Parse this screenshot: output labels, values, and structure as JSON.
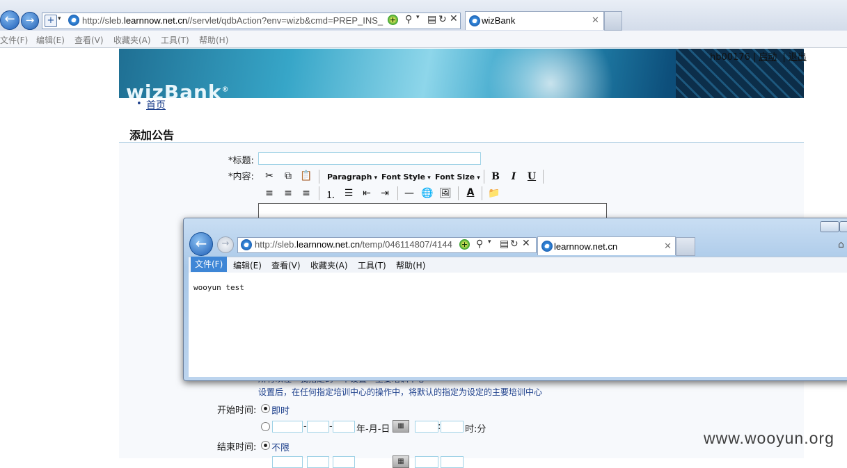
{
  "bg_browser": {
    "url_prefix": "http://sleb.",
    "url_host": "learnnow.net.cn",
    "url_suffix": "//servlet/qdbAction?env=wizb&cmd=PREP_INS_",
    "tab_title": "wizBank",
    "menu": [
      "文件(F)",
      "编辑(E)",
      "查看(V)",
      "收藏夹(A)",
      "工具(T)",
      "帮助(H)"
    ]
  },
  "header": {
    "logo": "wizBank",
    "logo_mark": "®",
    "user_id": "hb00176",
    "separator": "|",
    "link_1": "启动",
    "link_2": "退出"
  },
  "nav": {
    "home": "首页"
  },
  "form": {
    "title": "添加公告",
    "subject_label": "*标题:",
    "subject_value": "",
    "content_label": "*内容:",
    "editor": {
      "paragraph": "Paragraph",
      "font_style": "Font Style",
      "font_size": "Font Size",
      "bold": "B",
      "italic": "I",
      "underline": "U"
    },
    "hint_partial": "所有以往一我指定的一中设置一主要培训中心",
    "hint": "设置后，在任何指定培训中心的操作中，将默认的指定为设定的主要培训中心",
    "start_label": "开始时间:",
    "start_now": "即时",
    "date_format": "年-月-日",
    "time_sep": ":",
    "time_format": "时:分",
    "date_sep": "-",
    "end_label": "结束时间:",
    "end_unlimited": "不限"
  },
  "popup": {
    "url_prefix": "http://sleb.",
    "url_host": "learnnow.net.cn",
    "url_suffix": "/temp/046114807/4144",
    "tab_title": "learnnow.net.cn",
    "menu": [
      "文件(F)",
      "编辑(E)",
      "查看(V)",
      "收藏夹(A)",
      "工具(T)",
      "帮助(H)"
    ],
    "content": "wooyun test"
  },
  "watermark": "www.wooyun.org"
}
